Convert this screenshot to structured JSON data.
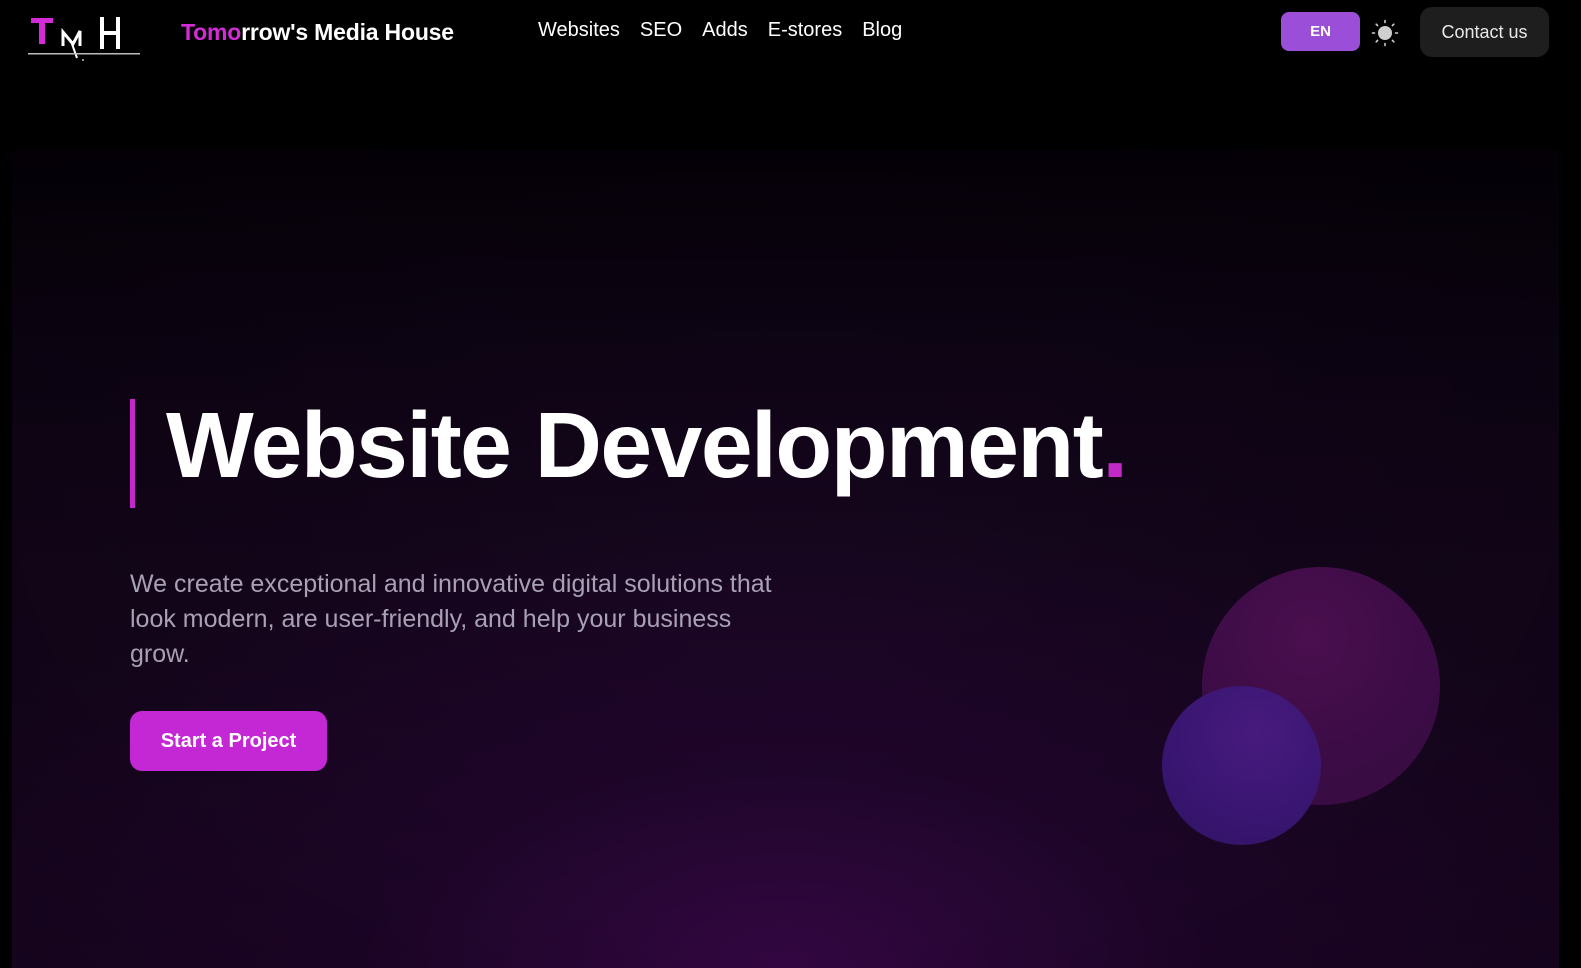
{
  "header": {
    "logo_text": "TMH",
    "brand_accent": "Tomo",
    "brand_rest": "rrow's Media House",
    "nav": [
      {
        "label": "Websites"
      },
      {
        "label": "SEO"
      },
      {
        "label": "Adds"
      },
      {
        "label": "E-stores"
      },
      {
        "label": "Blog"
      }
    ],
    "language": "EN",
    "theme_icon": "sun-icon",
    "contact_label": "Contact us"
  },
  "hero": {
    "title": "Website Development",
    "title_dot": ".",
    "description": "We create exceptional and innovative digital solutions that look modern, are user-friendly, and help your business grow.",
    "cta_label": "Start a Project"
  },
  "colors": {
    "accent": "#c428d4",
    "lang_button": "#9b4fd9",
    "background": "#000000",
    "contact_button": "#1e1e1e"
  }
}
